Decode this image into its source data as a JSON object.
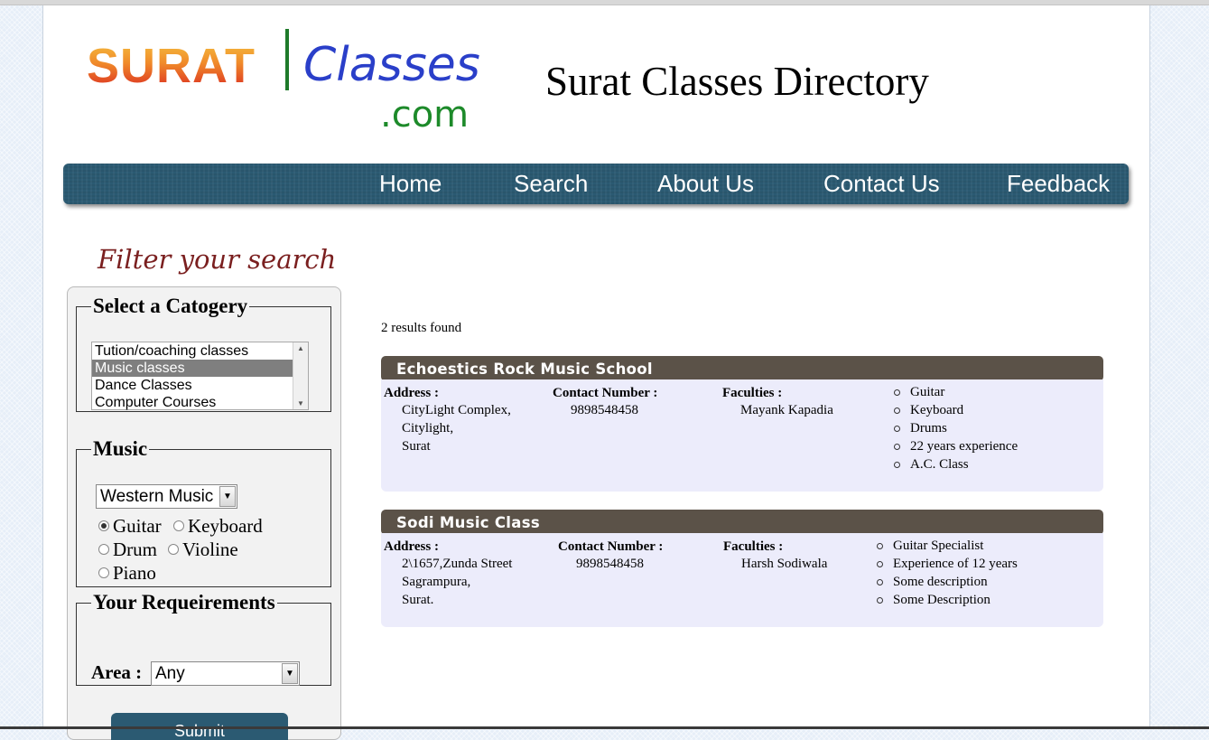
{
  "header": {
    "logo_main": "SURAT",
    "logo_classes": "Classes",
    "logo_com": ".com",
    "site_title": "Surat Classes Directory"
  },
  "nav": {
    "items": [
      "Home",
      "Search",
      "About Us",
      "Contact Us",
      "Feedback"
    ]
  },
  "filter": {
    "heading": "Filter your search",
    "category": {
      "legend": "Select a Catogery",
      "options": [
        "Tution/coaching classes",
        "Music classes",
        "Dance Classes",
        "Computer Courses"
      ],
      "selected": "Music classes"
    },
    "music": {
      "legend": "Music",
      "type_selected": "Western Music",
      "instruments": [
        {
          "label": "Guitar",
          "checked": true
        },
        {
          "label": "Keyboard",
          "checked": false
        },
        {
          "label": "Drum",
          "checked": false
        },
        {
          "label": "Violine",
          "checked": false
        },
        {
          "label": "Piano",
          "checked": false
        }
      ]
    },
    "requirements": {
      "legend": "Your Requeirements",
      "area_label": "Area :",
      "area_selected": "Any"
    },
    "submit_label": "Submit"
  },
  "results": {
    "count_text": "2 results found",
    "address_label": "Address :",
    "contact_label": "Contact Number :",
    "faculties_label": "Faculties :",
    "items": [
      {
        "name": "Echoestics Rock Music School",
        "address": [
          "CityLight Complex,",
          "Citylight,",
          "Surat"
        ],
        "contact": "9898548458",
        "faculty": "Mayank Kapadia",
        "features": [
          "Guitar",
          "Keyboard",
          "Drums",
          "22 years experience",
          "A.C. Class"
        ]
      },
      {
        "name": "Sodi Music Class",
        "address": [
          "2\\1657,Zunda Street",
          "Sagrampura,",
          "Surat."
        ],
        "contact": "9898548458",
        "faculty": "Harsh Sodiwala",
        "features": [
          "Guitar Specialist",
          "Experience of 12 years",
          "Some description",
          "Some Description"
        ]
      }
    ]
  },
  "colors": {
    "nav_bg": "#2b5a72",
    "card_header_bg": "#5b5248",
    "card_body_bg": "#ececfb",
    "filter_heading": "#7a1f1f"
  }
}
